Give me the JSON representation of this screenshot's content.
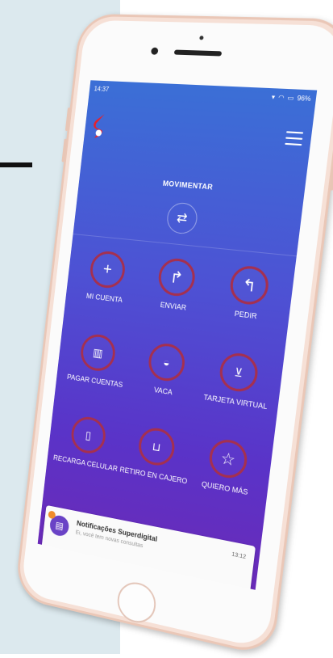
{
  "status_bar": {
    "time": "14:37",
    "battery": "96%"
  },
  "header": {
    "logo_icon": "superdigital-logo",
    "menu_icon": "hamburger-menu-icon"
  },
  "movimentar": {
    "title": "MOVIMENTAR",
    "icon": "transfer-arrows-icon"
  },
  "actions": [
    {
      "label": "MI CUENTA",
      "icon": "plus-icon"
    },
    {
      "label": "ENVIAR",
      "icon": "share-arrow-icon"
    },
    {
      "label": "PEDIR",
      "icon": "return-arrow-icon"
    },
    {
      "label": "PAGAR CUENTAS",
      "icon": "barcode-icon"
    },
    {
      "label": "VACA",
      "icon": "cow-icon"
    },
    {
      "label": "TARJETA VIRTUAL",
      "icon": "cart-icon"
    },
    {
      "label": "RECARGA CELULAR",
      "icon": "mobile-phone-icon"
    },
    {
      "label": "RETIRO EN CAJERO",
      "icon": "cash-withdraw-icon"
    },
    {
      "label": "QUIERO MÁS",
      "icon": "star-icon"
    }
  ],
  "notification": {
    "title": "Notificações Superdigital",
    "time": "13:12",
    "body": "Ei, você tem novas consultas"
  },
  "colors": {
    "gradient_top": "#3b6fd6",
    "gradient_bottom": "#6a2ab8",
    "circle_border": "#a5304f",
    "phone_frame": "#f6e0d6",
    "background_panel": "#dce9ee"
  }
}
